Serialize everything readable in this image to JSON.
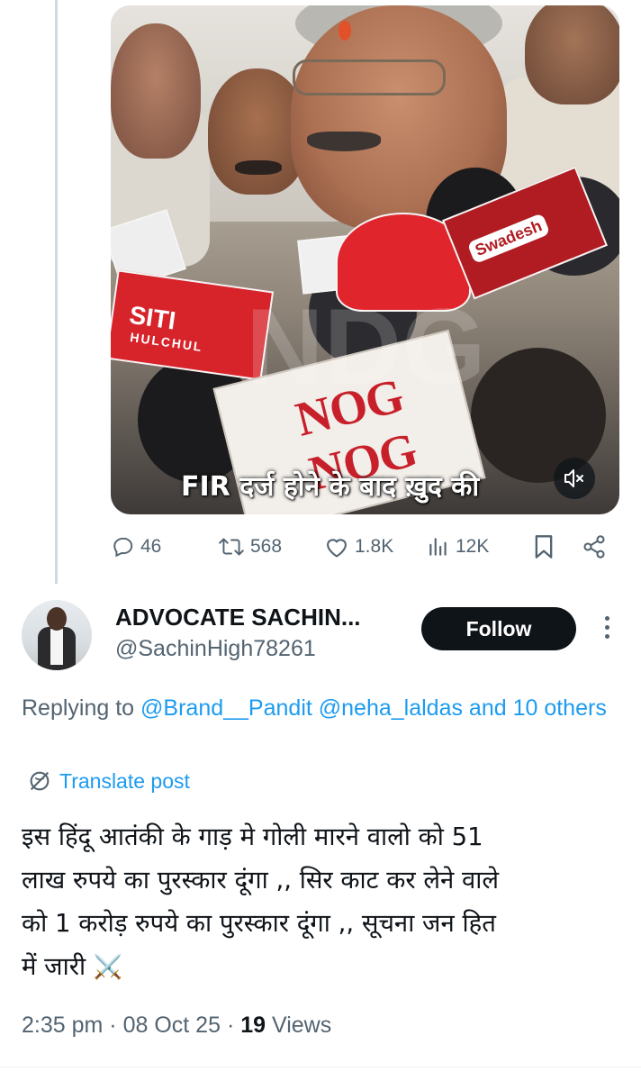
{
  "media": {
    "caption": "FIR दर्ज होने के बाद ख़ुद की",
    "watermark": "NDG",
    "mic_flags": {
      "siti_line1": "SITI",
      "siti_line2": "HULCHUL",
      "swadesh": "Swadesh",
      "nog": "NOG NOG"
    }
  },
  "parent_post_actions": {
    "replies": "46",
    "reposts": "568",
    "likes": "1.8K",
    "views": "12K"
  },
  "reply": {
    "author_name": "ADVOCATE SACHIN...",
    "author_handle": "@SachinHigh78261",
    "follow_label": "Follow",
    "replying_prefix": "Replying to",
    "replying_to": "@Brand__Pandit @neha_laldas and 10 others",
    "translate_label": "Translate post",
    "text_lines": [
      "इस हिंदू आतंकी के गाड़ मे गोली मारने वालो को 51",
      "लाख रुपये का पुरस्कार दूंगा  ,, सिर काट कर लेने वाले",
      "को 1 करोड़ रुपये का पुरस्कार दूंगा ,, सूचना जन हित",
      "में जारी"
    ],
    "emoji": "⚔️",
    "time": "2:35 pm",
    "date": "08 Oct 25",
    "views_count": "19",
    "views_label": "Views"
  },
  "colors": {
    "accent": "#1d9bf0",
    "secondary_text": "#536471",
    "primary_text": "#0f1419",
    "follow_bg": "#0f1419"
  },
  "icons": [
    "reply-icon",
    "repost-icon",
    "like-icon",
    "views-icon",
    "bookmark-icon",
    "share-icon",
    "mute-icon",
    "more-icon",
    "translate-icon"
  ]
}
